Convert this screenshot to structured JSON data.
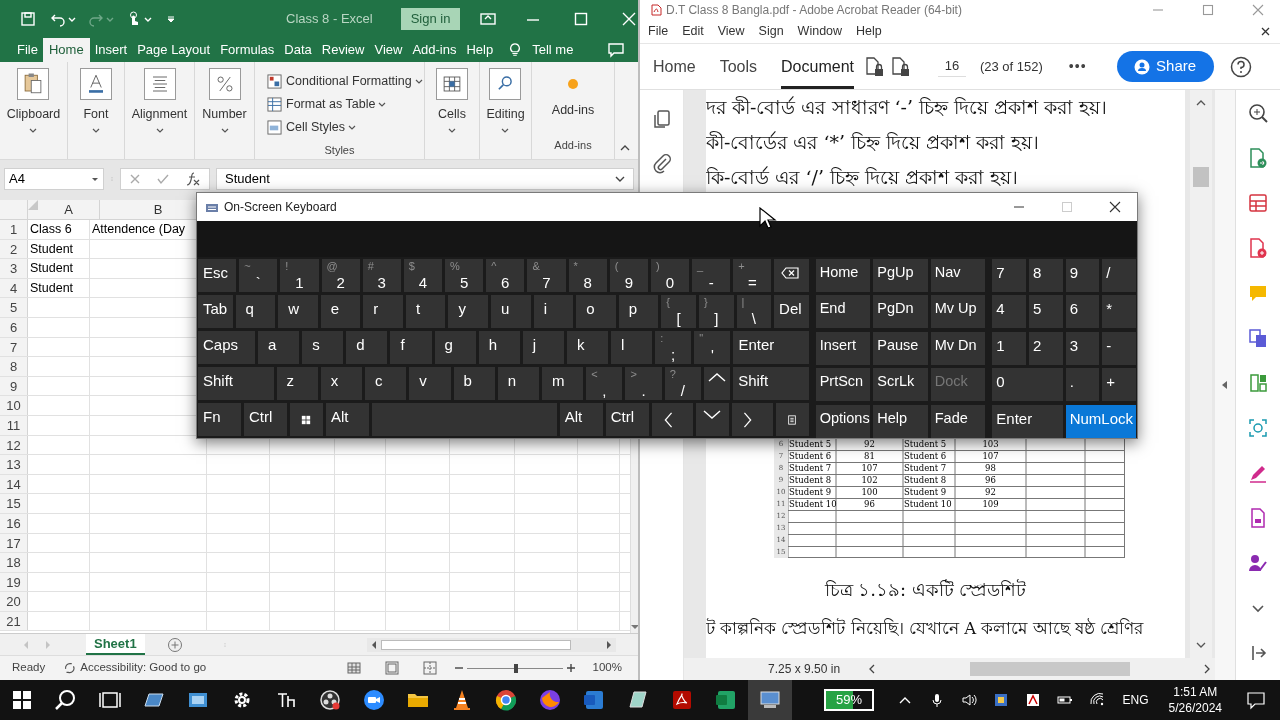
{
  "excel": {
    "title": "Class 8  -  Excel",
    "sign_in": "Sign in",
    "tabs": [
      {
        "label": "File",
        "selected": false
      },
      {
        "label": "Home",
        "selected": true
      },
      {
        "label": "Insert",
        "selected": false
      },
      {
        "label": "Page Layout",
        "selected": false
      },
      {
        "label": "Formulas",
        "selected": false
      },
      {
        "label": "Data",
        "selected": false
      },
      {
        "label": "Review",
        "selected": false
      },
      {
        "label": "View",
        "selected": false
      },
      {
        "label": "Add-ins",
        "selected": false
      },
      {
        "label": "Help",
        "selected": false
      }
    ],
    "tell_me": "Tell me",
    "ribbon": [
      {
        "kind": "big",
        "label": "Clipboard"
      },
      {
        "kind": "big",
        "label": "Font"
      },
      {
        "kind": "big",
        "label": "Alignment"
      },
      {
        "kind": "big",
        "label": "Number"
      },
      {
        "kind": "styles",
        "items": [
          "Conditional Formatting",
          "Format as Table",
          "Cell Styles"
        ],
        "label": "Styles"
      },
      {
        "kind": "big",
        "label": "Cells"
      },
      {
        "kind": "big",
        "label": "Editing"
      },
      {
        "kind": "addins",
        "label": "Add-ins",
        "group_label": "Add-ins"
      }
    ],
    "name_box": "A4",
    "formula": "Student",
    "columns": [
      "A",
      "B"
    ],
    "rows": [
      {
        "number": "1",
        "cells": [
          "Class 6",
          "Attendence (Day"
        ]
      },
      {
        "number": "2",
        "cells": [
          "Student"
        ]
      },
      {
        "number": "3",
        "cells": [
          "Student"
        ]
      },
      {
        "number": "4",
        "cells": [
          "Student"
        ]
      },
      {
        "number": "5"
      },
      {
        "number": "6"
      },
      {
        "number": "7"
      },
      {
        "number": "8"
      },
      {
        "number": "9"
      },
      {
        "number": "10"
      },
      {
        "number": "11"
      },
      {
        "number": "12"
      },
      {
        "number": "13"
      },
      {
        "number": "14"
      },
      {
        "number": "15"
      },
      {
        "number": "16"
      },
      {
        "number": "17"
      },
      {
        "number": "18"
      },
      {
        "number": "19"
      },
      {
        "number": "20"
      },
      {
        "number": "21"
      }
    ],
    "sheet_tabs": [
      {
        "label": "Sheet1",
        "selected": true
      }
    ],
    "status": "Ready",
    "accessibility": "Accessibility: Good to go",
    "zoom_slider": {
      "level": 0.52
    },
    "zoom": "100%"
  },
  "acrobat": {
    "title": "D.T Class 8 Bangla.pdf - Adobe Acrobat Reader (64-bit)",
    "menu": [
      "File",
      "Edit",
      "View",
      "Sign",
      "Window",
      "Help"
    ],
    "tabs": [
      {
        "label": "Home",
        "selected": false
      },
      {
        "label": "Tools",
        "selected": false
      },
      {
        "label": "Document",
        "selected": true
      }
    ],
    "page": "16",
    "page_count": "(23 of 152)",
    "more": "•••",
    "share": "Share",
    "lines": [
      "দর কী-বোর্ড এর সাধারণ ‘-’ চিহ্ন দিয়ে প্রকাশ করা হয়।",
      "কী-বোর্ডের এর ‘*’ চিহ্ন দিয়ে প্রকাশ করা হয়।",
      "কি-বোর্ড এর ‘/’ চিহ্ন দিয়ে প্রকাশ করা হয়।"
    ],
    "table": {
      "rows": [
        {
          "number": "6",
          "cells": [
            "Student 5",
            "92",
            "Student 5",
            "103"
          ]
        },
        {
          "number": "7",
          "cells": [
            "Student 6",
            "81",
            "Student 6",
            "107"
          ]
        },
        {
          "number": "8",
          "cells": [
            "Student 7",
            "107",
            "Student 7",
            "98"
          ]
        },
        {
          "number": "9",
          "cells": [
            "Student 8",
            "102",
            "Student 8",
            "96"
          ]
        },
        {
          "number": "10",
          "cells": [
            "Student 9",
            "100",
            "Student 9",
            "92"
          ]
        },
        {
          "number": "11",
          "cells": [
            "Student 10",
            "96",
            "Student 10",
            "109"
          ]
        },
        {
          "number": "12"
        },
        {
          "number": "13"
        },
        {
          "number": "14"
        },
        {
          "number": "15"
        }
      ]
    },
    "caption": "চিত্র ১.১৯: একটি স্প্রেডশিট",
    "paragraph": "ট কাল্পনিক স্প্রেডশিট নিয়েছি। যেখানে A কলামে আছে ষষ্ঠ শ্রেণির",
    "page_size": "7.25 x 9.50 in"
  },
  "keyboard": {
    "title": "On-Screen Keyboard",
    "rows": [
      {
        "keys": [
          {
            "kind": "key",
            "label": "Esc"
          },
          {
            "kind": "key",
            "shift": "~",
            "label": "`"
          },
          {
            "kind": "key",
            "shift": "!",
            "label": "1"
          },
          {
            "kind": "key",
            "shift": "@",
            "label": "2"
          },
          {
            "kind": "key",
            "shift": "#",
            "label": "3"
          },
          {
            "kind": "key",
            "shift": "$",
            "label": "4"
          },
          {
            "kind": "key",
            "shift": "%",
            "label": "5"
          },
          {
            "kind": "key",
            "shift": "^",
            "label": "6"
          },
          {
            "kind": "key",
            "shift": "&",
            "label": "7"
          },
          {
            "kind": "key",
            "shift": "*",
            "label": "8"
          },
          {
            "kind": "key",
            "shift": "(",
            "label": "9"
          },
          {
            "kind": "key",
            "shift": ")",
            "label": "0"
          },
          {
            "kind": "key",
            "shift": "_",
            "label": "-"
          },
          {
            "kind": "key",
            "shift": "+",
            "label": "="
          },
          {
            "kind": "backspace"
          }
        ]
      },
      {
        "keys": [
          {
            "kind": "key",
            "label": "Tab"
          },
          {
            "kind": "key",
            "label": "q"
          },
          {
            "kind": "key",
            "label": "w"
          },
          {
            "kind": "key",
            "label": "e"
          },
          {
            "kind": "key",
            "label": "r"
          },
          {
            "kind": "key",
            "label": "t"
          },
          {
            "kind": "key",
            "label": "y"
          },
          {
            "kind": "key",
            "label": "u"
          },
          {
            "kind": "key",
            "label": "i"
          },
          {
            "kind": "key",
            "label": "o"
          },
          {
            "kind": "key",
            "label": "p"
          },
          {
            "kind": "key",
            "shift": "{",
            "label": "["
          },
          {
            "kind": "key",
            "shift": "}",
            "label": "]"
          },
          {
            "kind": "key",
            "shift": "|",
            "label": "\\"
          },
          {
            "kind": "key",
            "label": "Del"
          }
        ]
      },
      {
        "keys": [
          {
            "kind": "wide",
            "label": "Caps"
          },
          {
            "kind": "key",
            "label": "a"
          },
          {
            "kind": "key",
            "label": "s"
          },
          {
            "kind": "key",
            "label": "d"
          },
          {
            "kind": "key",
            "label": "f"
          },
          {
            "kind": "key",
            "label": "g"
          },
          {
            "kind": "key",
            "label": "h"
          },
          {
            "kind": "key",
            "label": "j"
          },
          {
            "kind": "key",
            "label": "k"
          },
          {
            "kind": "key",
            "label": "l"
          },
          {
            "kind": "key",
            "shift": ":",
            "label": ";"
          },
          {
            "kind": "key",
            "shift": "\"",
            "label": "'"
          },
          {
            "kind": "wider",
            "label": "Enter"
          }
        ]
      },
      {
        "keys": [
          {
            "kind": "wider",
            "label": "Shift"
          },
          {
            "kind": "key",
            "label": "z"
          },
          {
            "kind": "key",
            "label": "x"
          },
          {
            "kind": "key",
            "label": "c"
          },
          {
            "kind": "key",
            "label": "v"
          },
          {
            "kind": "key",
            "label": "b"
          },
          {
            "kind": "key",
            "label": "n"
          },
          {
            "kind": "key",
            "label": "m"
          },
          {
            "kind": "key",
            "shift": "<",
            "label": ","
          },
          {
            "kind": "key",
            "shift": ">",
            "label": "."
          },
          {
            "kind": "key",
            "shift": "?",
            "label": "/"
          },
          {
            "kind": "up"
          },
          {
            "kind": "wider",
            "label": "Shift"
          }
        ]
      },
      {
        "keys": [
          {
            "kind": "key",
            "label": "Fn"
          },
          {
            "kind": "key",
            "label": "Ctrl"
          },
          {
            "kind": "windows"
          },
          {
            "kind": "key",
            "label": "Alt"
          },
          {
            "kind": "space"
          },
          {
            "kind": "key",
            "label": "Alt"
          },
          {
            "kind": "key",
            "label": "Ctrl"
          },
          {
            "kind": "left"
          },
          {
            "kind": "down"
          },
          {
            "kind": "right"
          },
          {
            "kind": "menu"
          }
        ]
      }
    ],
    "nav": [
      {
        "label": "Home",
        "disabled": false
      },
      {
        "label": "PgUp",
        "disabled": false
      },
      {
        "label": "Nav",
        "disabled": false
      },
      {
        "label": "End",
        "disabled": false
      },
      {
        "label": "PgDn",
        "disabled": false
      },
      {
        "label": "Mv Up",
        "disabled": false
      },
      {
        "label": "Insert",
        "disabled": false
      },
      {
        "label": "Pause",
        "disabled": false
      },
      {
        "label": "Mv Dn",
        "disabled": false
      },
      {
        "label": "PrtScn",
        "disabled": false
      },
      {
        "label": "ScrLk",
        "disabled": false
      },
      {
        "label": "Dock",
        "disabled": true
      },
      {
        "label": "Options",
        "disabled": false
      },
      {
        "label": "Help",
        "disabled": false
      },
      {
        "label": "Fade",
        "disabled": false
      }
    ],
    "numpad": [
      {
        "label": "7",
        "kind": "key",
        "on": false
      },
      {
        "label": "8",
        "kind": "key",
        "on": false
      },
      {
        "label": "9",
        "kind": "key",
        "on": false
      },
      {
        "label": "/",
        "kind": "key",
        "on": false
      },
      {
        "label": "4",
        "kind": "key",
        "on": false
      },
      {
        "label": "5",
        "kind": "key",
        "on": false
      },
      {
        "label": "6",
        "kind": "key",
        "on": false
      },
      {
        "label": "*",
        "kind": "key",
        "on": false
      },
      {
        "label": "1",
        "kind": "key",
        "on": false
      },
      {
        "label": "2",
        "kind": "key",
        "on": false
      },
      {
        "label": "3",
        "kind": "key",
        "on": false
      },
      {
        "label": "-",
        "kind": "key",
        "on": false
      },
      {
        "label": "0",
        "kind": "wide",
        "on": false
      },
      {
        "label": ".",
        "kind": "key",
        "on": false
      },
      {
        "label": "+",
        "kind": "key",
        "on": false
      },
      {
        "label": "Enter",
        "kind": "wide",
        "on": false
      },
      {
        "label": "NumLock",
        "kind": "wide",
        "on": true
      }
    ]
  },
  "taskbar": {
    "battery": {
      "reading": "59%",
      "level": 0.59
    },
    "language": "ENG",
    "time": "1:51 AM",
    "date": "5/26/2024"
  }
}
